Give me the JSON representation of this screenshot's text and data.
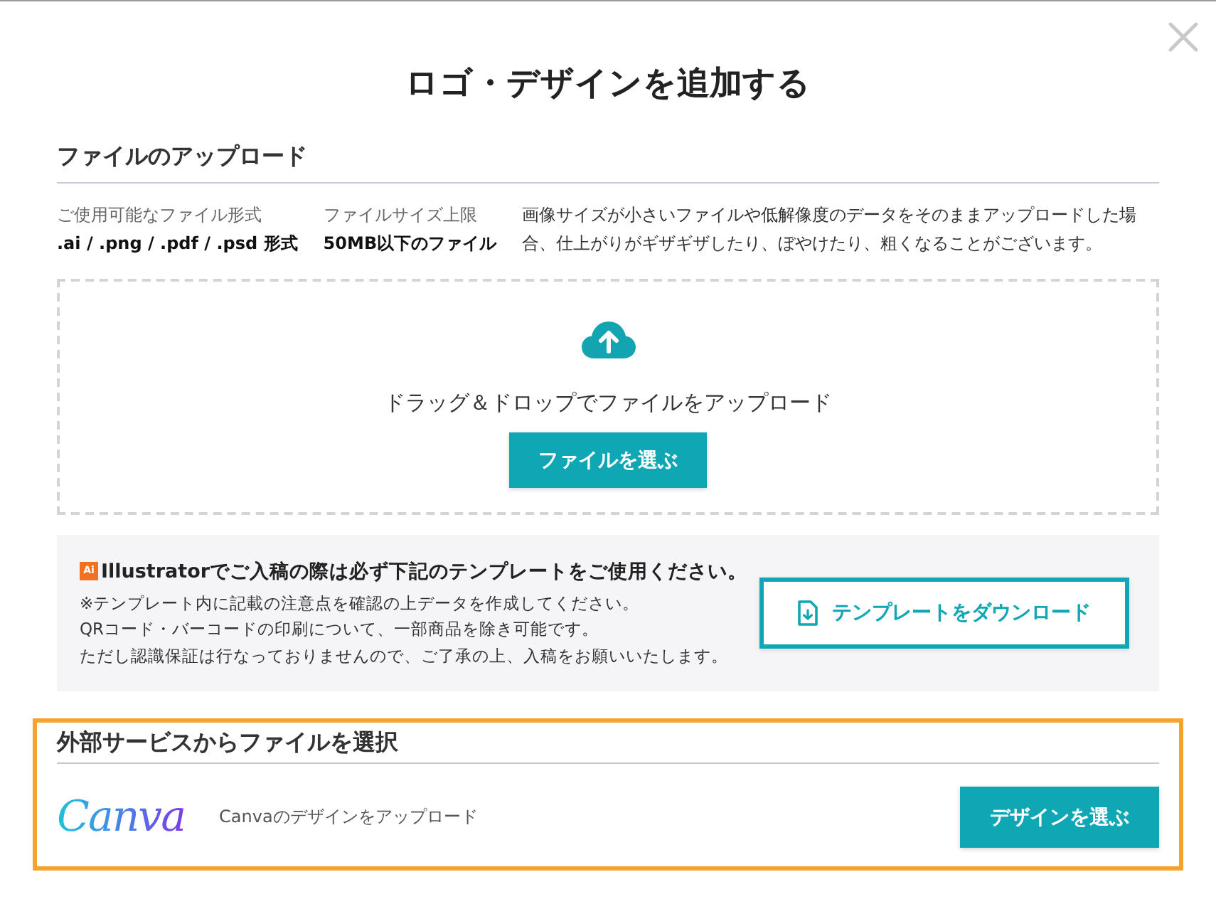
{
  "dialog": {
    "title": "ロゴ・デザインを追加する"
  },
  "upload_section": {
    "heading": "ファイルのアップロード",
    "specs": [
      {
        "label": "ご使用可能なファイル形式",
        "value": ".ai / .png / .pdf / .psd 形式"
      },
      {
        "label": "ファイルサイズ上限",
        "value": "50MB以下のファイル"
      }
    ],
    "note": "画像サイズが小さいファイルや低解像度のデータをそのままアップロードした場合、仕上がりがギザギザしたり、ぼやけたり、粗くなることがございます。"
  },
  "dropzone": {
    "text": "ドラッグ＆ドロップでファイルをアップロード",
    "button": "ファイルを選ぶ"
  },
  "template_notice": {
    "badge": "Ai",
    "heading": "Illustratorでご入稿の際は必ず下記のテンプレートをご使用ください。",
    "lines": [
      "※テンプレート内に記載の注意点を確認の上データを作成してください。",
      "QRコード・バーコードの印刷について、一部商品を除き可能です。",
      "ただし認識保証は行なっておりませんので、ご了承の上、入稿をお願いいたします。"
    ],
    "button": "テンプレートをダウンロード"
  },
  "external_section": {
    "highlighted": true,
    "heading": "外部サービスからファイルを選択",
    "services": [
      {
        "logo": "Canva",
        "description": "Canvaのデザインをアップロード",
        "button": "デザインを選ぶ"
      }
    ]
  }
}
